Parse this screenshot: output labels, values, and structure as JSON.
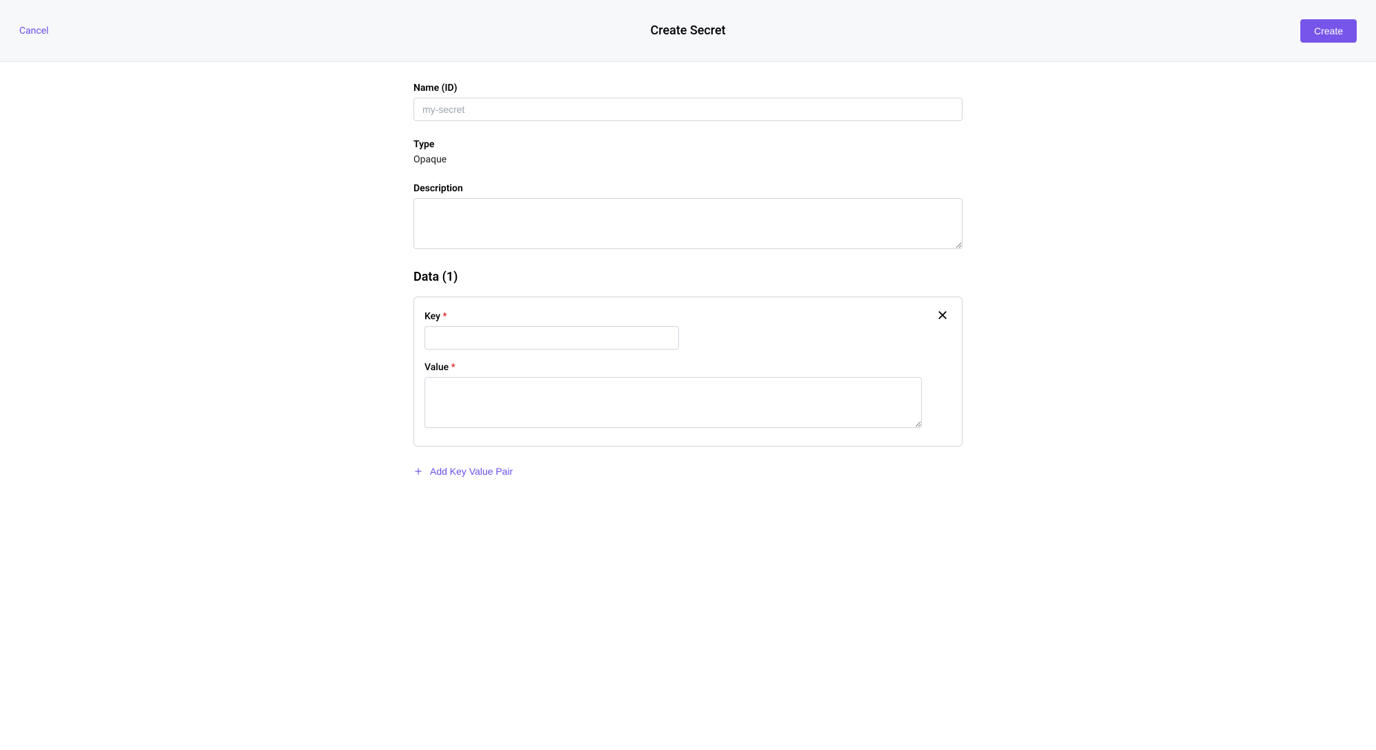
{
  "header": {
    "cancel": "Cancel",
    "title": "Create Secret",
    "create": "Create"
  },
  "form": {
    "name_label": "Name (ID)",
    "name_placeholder": "my-secret",
    "name_value": "",
    "type_label": "Type",
    "type_value": "Opaque",
    "description_label": "Description",
    "description_value": ""
  },
  "data_section": {
    "title": "Data (1)",
    "items": [
      {
        "key_label": "Key",
        "key_value": "",
        "value_label": "Value",
        "value_value": ""
      }
    ],
    "add_label": "Add Key Value Pair",
    "required_marker": "*"
  }
}
